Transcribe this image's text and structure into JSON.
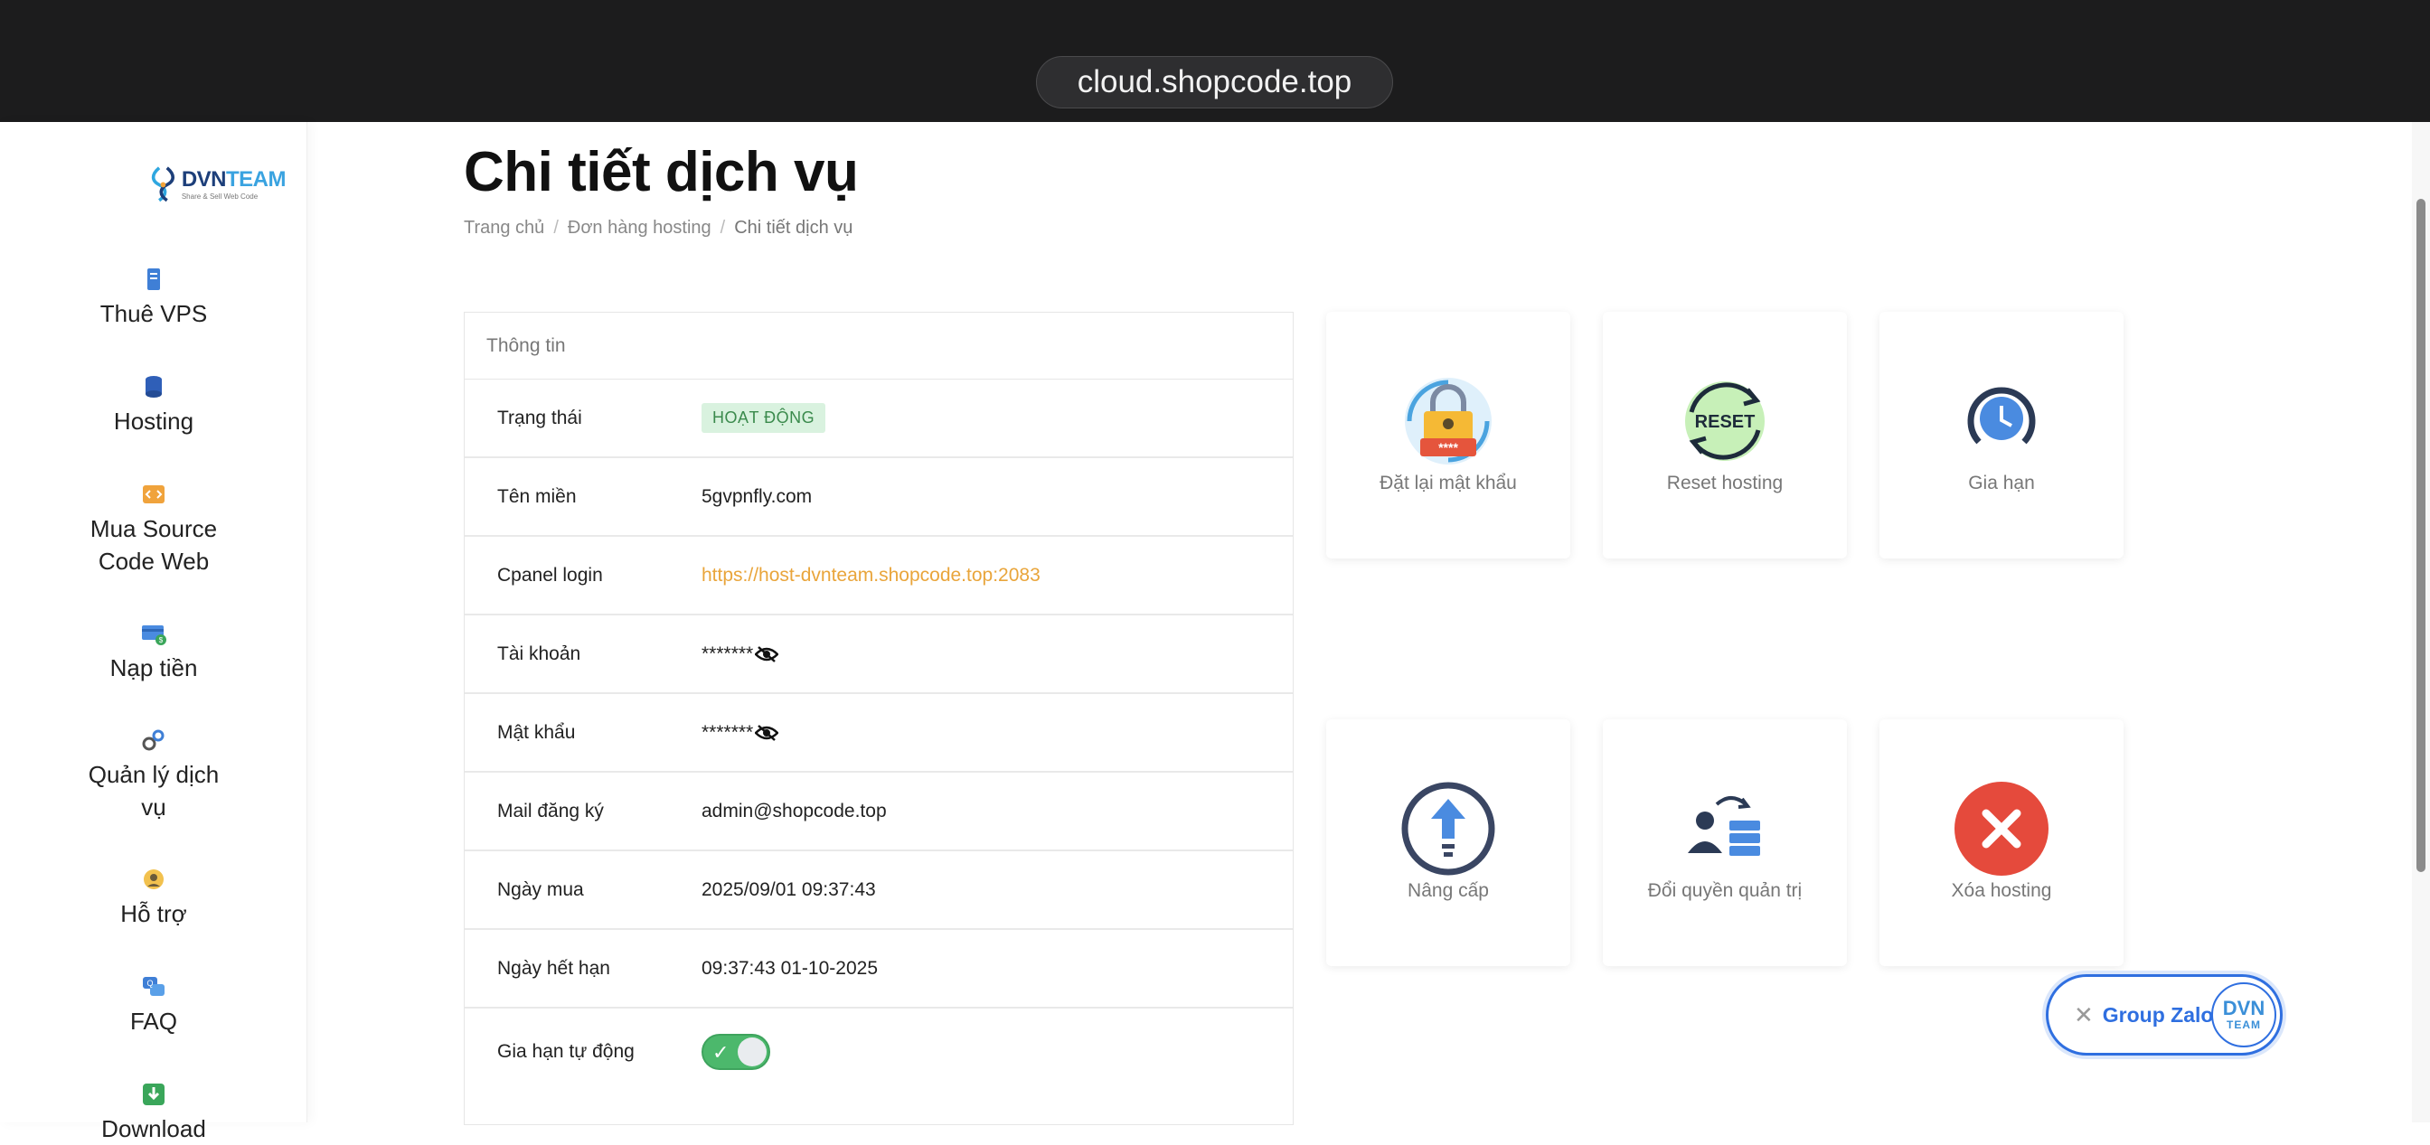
{
  "browser": {
    "url": "cloud.shopcode.top"
  },
  "logo": {
    "brand_a": "DVN",
    "brand_b": "TEAM",
    "tagline": "Share & Sell Web Code"
  },
  "sidebar": {
    "items": [
      {
        "label": "Thuê VPS",
        "icon": "server-icon"
      },
      {
        "label": "Hosting",
        "icon": "database-icon"
      },
      {
        "label": "Mua Source Code Web",
        "icon": "code-icon"
      },
      {
        "label": "Nạp tiền",
        "icon": "wallet-icon"
      },
      {
        "label": "Quản lý dịch vụ",
        "icon": "gears-icon"
      },
      {
        "label": "Hỗ trợ",
        "icon": "support-icon"
      },
      {
        "label": "FAQ",
        "icon": "faq-icon"
      },
      {
        "label": "Download",
        "icon": "download-icon"
      }
    ]
  },
  "page": {
    "title": "Chi tiết dịch vụ",
    "breadcrumb": [
      "Trang chủ",
      "Đơn hàng hosting",
      "Chi tiết dịch vụ"
    ]
  },
  "info": {
    "header": "Thông tin",
    "rows": [
      {
        "label": "Trạng thái",
        "value": "HOẠT ĐỘNG"
      },
      {
        "label": "Tên miền",
        "value": "5gvpnfly.com"
      },
      {
        "label": "Cpanel login",
        "value": "https://host-dvnteam.shopcode.top:2083"
      },
      {
        "label": "Tài khoản",
        "value": "*******"
      },
      {
        "label": "Mật khẩu",
        "value": "*******"
      },
      {
        "label": "Mail đăng ký",
        "value": "admin@shopcode.top"
      },
      {
        "label": "Ngày mua",
        "value": "2025/09/01 09:37:43"
      },
      {
        "label": "Ngày hết hạn",
        "value": "09:37:43 01-10-2025"
      },
      {
        "label": "Gia hạn tự động",
        "value": "on"
      }
    ]
  },
  "actions": [
    {
      "label": "Đặt lại mật khẩu",
      "icon": "lock-reset-icon"
    },
    {
      "label": "Reset hosting",
      "icon": "reset-icon",
      "icon_text": "RESET",
      "icon_stars": "****"
    },
    {
      "label": "Gia hạn",
      "icon": "clock-renew-icon"
    },
    {
      "label": "Nâng cấp",
      "icon": "upgrade-icon"
    },
    {
      "label": "Đổi quyền quản trị",
      "icon": "admin-transfer-icon"
    },
    {
      "label": "Xóa hosting",
      "icon": "delete-icon"
    }
  ],
  "zalo": {
    "label": "Group Zalo",
    "avatar_top": "DVN",
    "avatar_bottom": "TEAM"
  },
  "colors": {
    "accent_link": "#e9a53b",
    "status_bg": "#d9f2df",
    "toggle_on": "#4cb86c",
    "zalo_blue": "#2f6fe0"
  }
}
